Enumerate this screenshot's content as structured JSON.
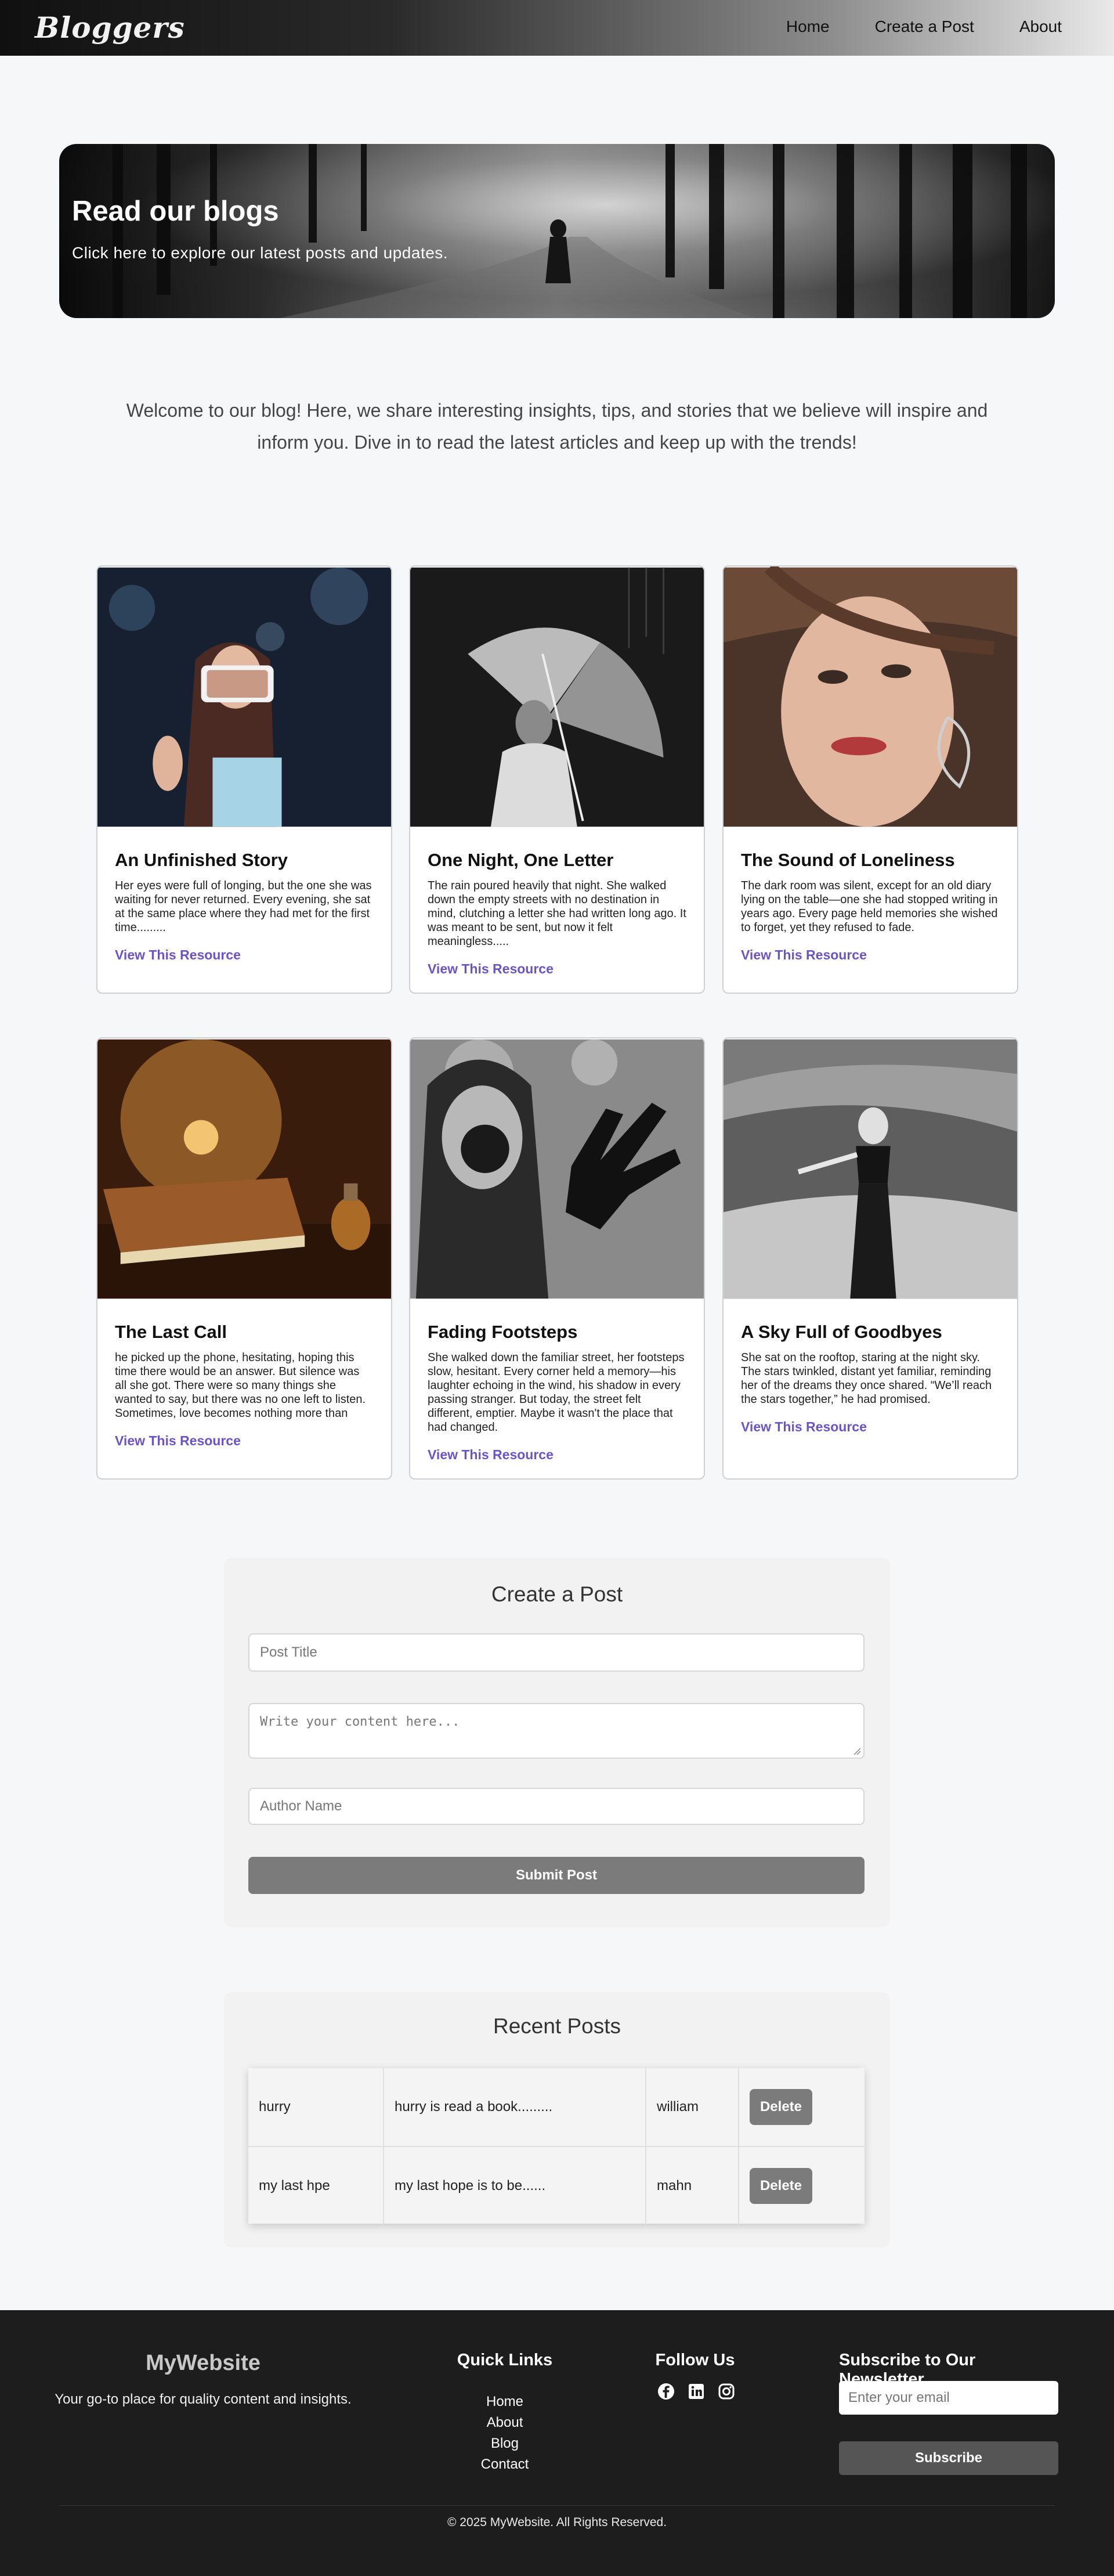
{
  "nav": {
    "logo": "Bloggers",
    "links": [
      "Home",
      "Create a Post",
      "About"
    ]
  },
  "hero": {
    "title": "Read our blogs",
    "subtitle": "Click here to explore our latest posts and updates."
  },
  "intro": "Welcome to our blog! Here, we share interesting insights, tips, and stories that we believe will inspire and inform you. Dive in to read the latest articles and keep up with the trends!",
  "cards": [
    {
      "title": "An Unfinished Story",
      "text": "Her eyes were full of longing, but the one she was waiting for never returned. Every evening, she sat at the same place where they had met for the first time.........",
      "link": "View This Resource"
    },
    {
      "title": "One Night, One Letter",
      "text": "The rain poured heavily that night. She walked down the empty streets with no destination in mind, clutching a letter she had written long ago. It was meant to be sent, but now it felt meaningless.....",
      "link": "View This Resource"
    },
    {
      "title": "The Sound of Loneliness",
      "text": "The dark room was silent, except for an old diary lying on the table—one she had stopped writing in years ago. Every page held memories she wished to forget, yet they refused to fade.",
      "link": "View This Resource"
    },
    {
      "title": "The Last Call",
      "text": "he picked up the phone, hesitating, hoping this time there would be an answer. But silence was all she got. There were so many things she wanted to say, but there was no one left to listen. Sometimes, love becomes nothing more than",
      "link": "View This Resource"
    },
    {
      "title": "Fading Footsteps",
      "text": "She walked down the familiar street, her footsteps slow, hesitant. Every corner held a memory—his laughter echoing in the wind, his shadow in every passing stranger. But today, the street felt different, emptier. Maybe it wasn't the place that had changed.",
      "link": "View This Resource"
    },
    {
      "title": "A Sky Full of Goodbyes",
      "text": "She sat on the rooftop, staring at the night sky. The stars twinkled, distant yet familiar, reminding her of the dreams they once shared. “We’ll reach the stars together,” he had promised.",
      "link": "View This Resource"
    }
  ],
  "create_post": {
    "title": "Create a Post",
    "title_placeholder": "Post Title",
    "content_placeholder": "Write your content here...",
    "author_placeholder": "Author Name",
    "submit_label": "Submit Post"
  },
  "recent_posts": {
    "title": "Recent Posts",
    "rows": [
      {
        "title": "hurry",
        "content": "hurry is read a book.........",
        "author": "william",
        "action": "Delete"
      },
      {
        "title": "my last hpe",
        "content": "my last hope is to be......",
        "author": "mahn",
        "action": "Delete"
      }
    ]
  },
  "footer": {
    "brand": "MyWebsite",
    "tagline": "Your go-to place for quality content and insights.",
    "quick_links_title": "Quick Links",
    "quick_links": [
      "Home",
      "About",
      "Blog",
      "Contact"
    ],
    "follow_title": "Follow Us",
    "social_icons": [
      "facebook-icon",
      "linkedin-icon",
      "instagram-icon"
    ],
    "newsletter_title": "Subscribe to Our Newsletter",
    "newsletter_placeholder": "Enter your email",
    "subscribe_label": "Subscribe",
    "copyright": "© 2025 MyWebsite. All Rights Reserved."
  }
}
